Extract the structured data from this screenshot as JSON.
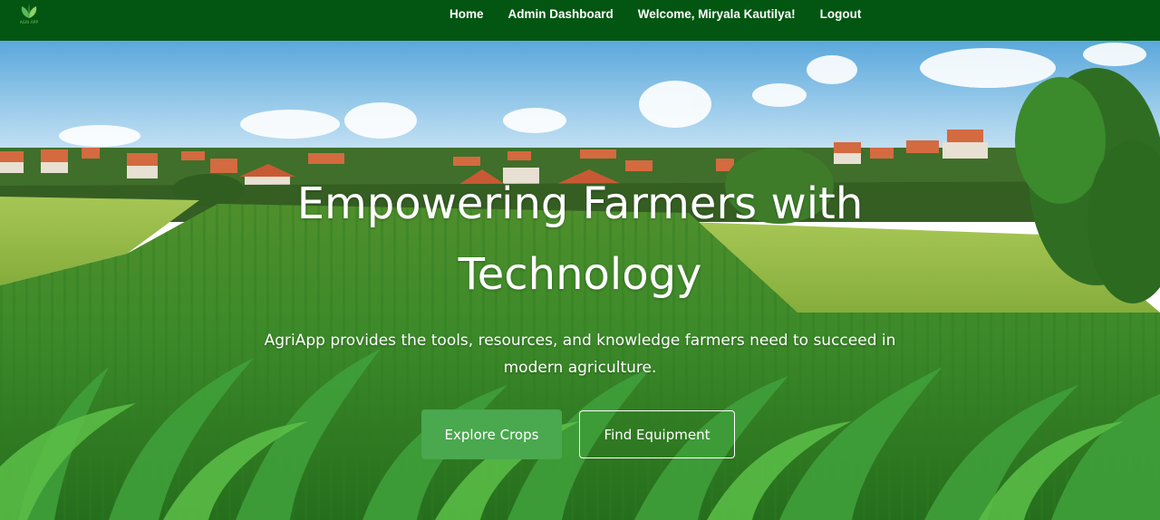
{
  "colors": {
    "navbar_bg": "#035612",
    "primary_button": "#4aa84e",
    "text_light": "#ffffff"
  },
  "brand": {
    "logo_icon": "leaf-icon",
    "logo_text": "AGRI APP"
  },
  "nav": {
    "items": [
      {
        "label": "Home"
      },
      {
        "label": "Admin Dashboard"
      },
      {
        "label": "Welcome, Miryala Kautilya!"
      },
      {
        "label": "Logout"
      }
    ]
  },
  "hero": {
    "title": "Empowering Farmers with Technology",
    "subtitle": "AgriApp provides the tools, resources, and knowledge farmers need to succeed in modern agriculture.",
    "buttons": {
      "explore": "Explore Crops",
      "equipment": "Find Equipment"
    }
  }
}
